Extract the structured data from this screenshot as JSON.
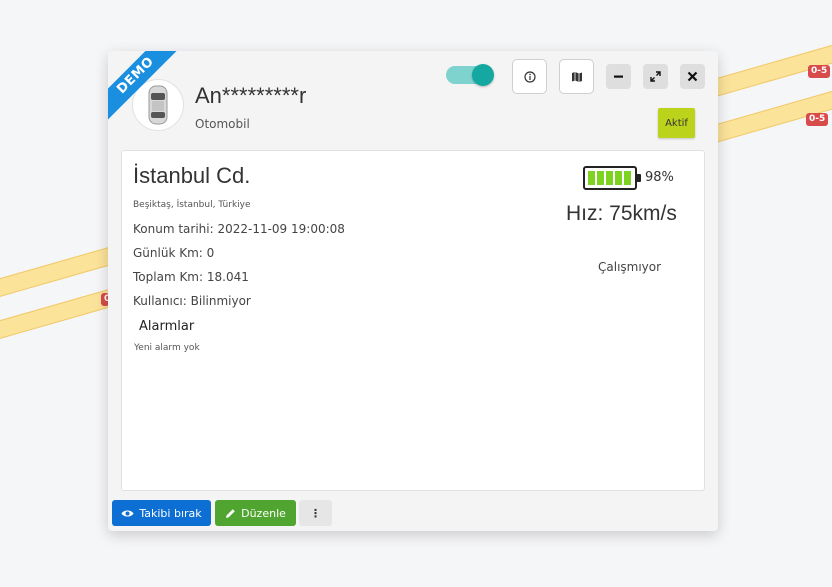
{
  "map": {
    "road_badges": [
      "0-5",
      "0-5",
      "0"
    ]
  },
  "card": {
    "ribbon": "DEMO",
    "vehicle_name": "An*********r",
    "vehicle_type": "Otomobil",
    "status": "Aktif",
    "tracking_toggle_on": true
  },
  "location": {
    "title": "İstanbul Cd.",
    "subtitle": "Beşiktaş, İstanbul, Türkiye",
    "position_date": "Konum tarihi: 2022-11-09 19:00:08",
    "daily_km": "Günlük Km: 0",
    "total_km": "Toplam Km: 18.041",
    "user": "Kullanıcı: Bilinmiyor"
  },
  "alarms": {
    "title": "Alarmlar",
    "empty": "Yeni alarm yok"
  },
  "telemetry": {
    "battery_level": 0.98,
    "battery_text": "98%",
    "speed": "Hız: 75km/s",
    "engine_state": "Çalışmıyor"
  },
  "footer": {
    "stop_tracking": "Takibi bırak",
    "edit": "Düzenle",
    "more": "⋮"
  },
  "colors": {
    "ribbon": "#1a8fe0",
    "toggle": "#14a8a1",
    "status_chip": "#bcd31b",
    "battery": "#7ed321",
    "stop_button": "#0d6fd4",
    "edit_button": "#4fa52f"
  }
}
